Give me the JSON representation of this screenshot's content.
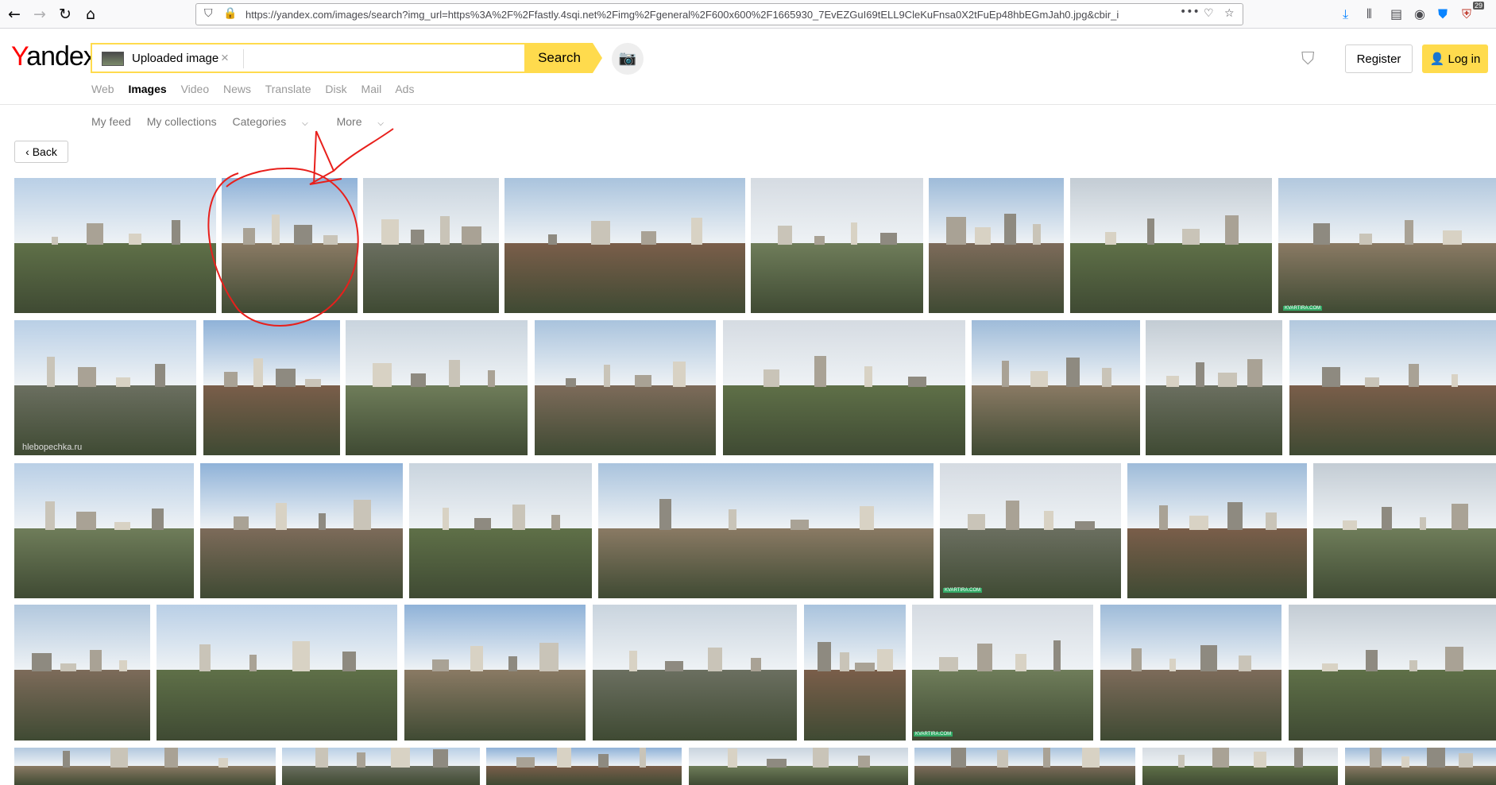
{
  "browser": {
    "url": "https://yandex.com/images/search?img_url=https%3A%2F%2Ffastly.4sqi.net%2Fimg%2Fgeneral%2F600x600%2F1665930_7EvEZGuI69tELL9CleKuFnsa0X2tFuEp48hbEGmJah0.jpg&cbir_i",
    "more_dots": "•••",
    "badge_count": "29"
  },
  "header": {
    "logo_y": "Y",
    "logo_rest": "andex",
    "search_chip_label": "Uploaded image",
    "search_button": "Search",
    "register": "Register",
    "login": "Log in"
  },
  "services": [
    "Web",
    "Images",
    "Video",
    "News",
    "Translate",
    "Disk",
    "Mail",
    "Ads"
  ],
  "subnav": {
    "my_feed": "My feed",
    "my_collections": "My collections",
    "categories": "Categories",
    "more": "More"
  },
  "back_label": "Back",
  "watermarks": {
    "chlebopechka": "hlebopechka.ru",
    "kvartira": "KVARTIRA.COM"
  },
  "colors": {
    "accent": "#ffdb4d",
    "logo_red": "#ff0000",
    "annotation_red": "#e8201c"
  }
}
